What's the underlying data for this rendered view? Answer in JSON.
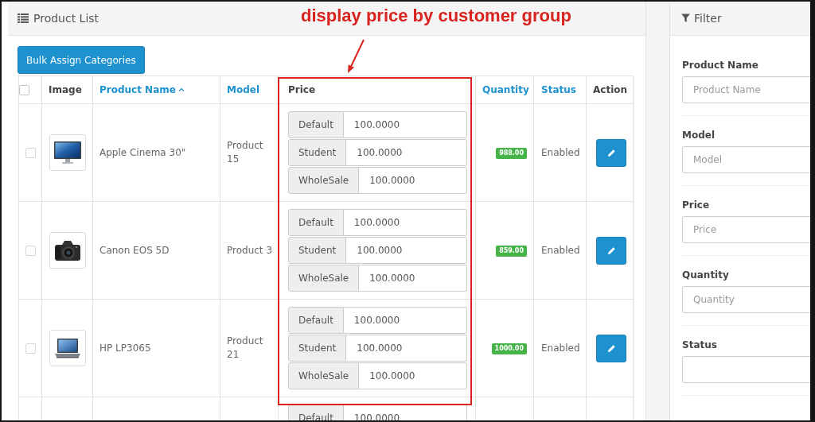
{
  "annotation": {
    "text": "display price by customer group"
  },
  "product_list": {
    "title": "Product List",
    "bulk_button": "Bulk Assign Categories",
    "columns": [
      {
        "kind": "checkbox",
        "checked": false
      },
      {
        "kind": "text",
        "label": "Image",
        "sorted": false
      },
      {
        "kind": "link",
        "label": "Product Name",
        "sorted": true
      },
      {
        "kind": "link",
        "label": "Model",
        "sorted": false
      },
      {
        "kind": "text",
        "label": "Price",
        "sorted": false
      },
      {
        "kind": "link",
        "label": "Quantity",
        "sorted": false
      },
      {
        "kind": "link",
        "label": "Status",
        "sorted": false
      },
      {
        "kind": "text",
        "label": "Action",
        "sorted": false
      }
    ],
    "rows": [
      {
        "checked": false,
        "image": {
          "kind": "monitor"
        },
        "name": "Apple Cinema 30\"",
        "model": "Product 15",
        "prices": [
          {
            "group": "Default",
            "value": "100.0000"
          },
          {
            "group": "Student",
            "value": "100.0000"
          },
          {
            "group": "WholeSale",
            "value": "100.0000"
          }
        ],
        "quantity": "988.00",
        "status": "Enabled",
        "actions": [
          {
            "kind": "edit"
          }
        ]
      },
      {
        "checked": false,
        "image": {
          "kind": "camera"
        },
        "name": "Canon EOS 5D",
        "model": "Product 3",
        "prices": [
          {
            "group": "Default",
            "value": "100.0000"
          },
          {
            "group": "Student",
            "value": "100.0000"
          },
          {
            "group": "WholeSale",
            "value": "100.0000"
          }
        ],
        "quantity": "859.00",
        "status": "Enabled",
        "actions": [
          {
            "kind": "edit"
          }
        ]
      },
      {
        "checked": false,
        "image": {
          "kind": "laptop"
        },
        "name": "HP LP3065",
        "model": "Product 21",
        "prices": [
          {
            "group": "Default",
            "value": "100.0000"
          },
          {
            "group": "Student",
            "value": "100.0000"
          },
          {
            "group": "WholeSale",
            "value": "100.0000"
          }
        ],
        "quantity": "1000.00",
        "status": "Enabled",
        "actions": [
          {
            "kind": "edit"
          }
        ]
      },
      {
        "prices": [
          {
            "group": "Default",
            "value": "100.0000"
          }
        ]
      }
    ]
  },
  "filter": {
    "title": "Filter",
    "fields": [
      {
        "kind": "input",
        "label": "Product Name",
        "placeholder": "Product Name"
      },
      {
        "kind": "input",
        "label": "Model",
        "placeholder": "Model"
      },
      {
        "kind": "input",
        "label": "Price",
        "placeholder": "Price"
      },
      {
        "kind": "input",
        "label": "Quantity",
        "placeholder": "Quantity"
      },
      {
        "kind": "select",
        "label": "Status"
      }
    ]
  }
}
